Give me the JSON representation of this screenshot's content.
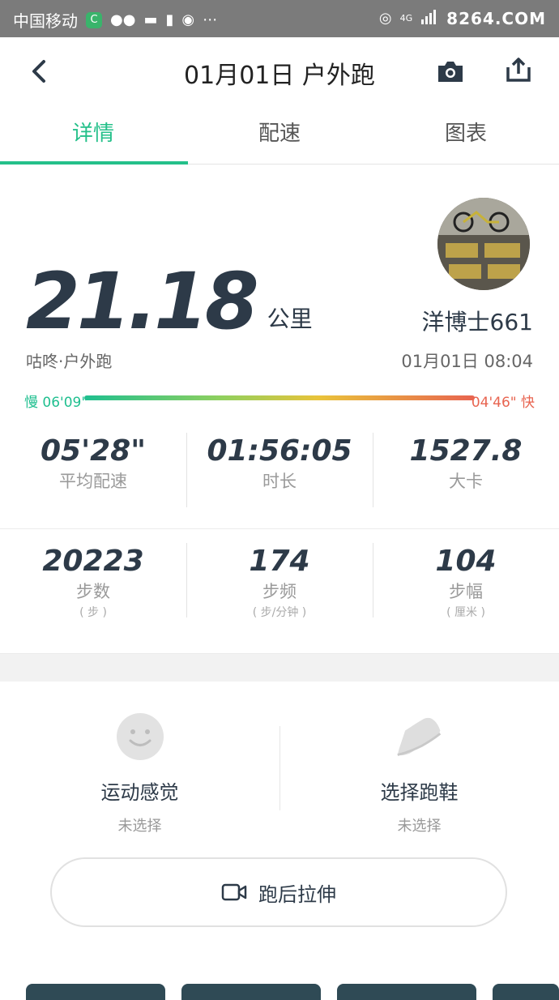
{
  "status_bar": {
    "carrier": "中国移动",
    "network": "4G",
    "watermark": "8264.COM"
  },
  "header": {
    "title": "01月01日 户外跑"
  },
  "tabs": [
    {
      "label": "详情",
      "active": true
    },
    {
      "label": "配速",
      "active": false
    },
    {
      "label": "图表",
      "active": false
    }
  ],
  "summary": {
    "distance": "21.18",
    "distance_unit": "公里",
    "subtitle": "咕咚·户外跑",
    "username": "洋博士661",
    "datetime": "01月01日 08:04"
  },
  "pace_range": {
    "slow_label": "慢 06'09\"",
    "fast_label": "04'46\" 快"
  },
  "stats_row1": [
    {
      "value": "05'28\"",
      "label": "平均配速"
    },
    {
      "value": "01:56:05",
      "label": "时长"
    },
    {
      "value": "1527.8",
      "label": "大卡"
    }
  ],
  "stats_row2": [
    {
      "value": "20223",
      "label": "步数",
      "unit": "( 步 )"
    },
    {
      "value": "174",
      "label": "步频",
      "unit": "( 步/分钟 )"
    },
    {
      "value": "104",
      "label": "步幅",
      "unit": "( 厘米 )"
    }
  ],
  "feel": {
    "feeling_title": "运动感觉",
    "feeling_sub": "未选择",
    "shoe_title": "选择跑鞋",
    "shoe_sub": "未选择"
  },
  "stretch_button": {
    "label": "跑后拉伸"
  },
  "colors": {
    "accent": "#24c08a",
    "text_dark": "#2d3a48",
    "pace_slow": "#1fbf8f",
    "pace_fast": "#e86450"
  },
  "icons": {
    "back": "chevron-left-icon",
    "camera": "camera-icon",
    "share": "share-icon",
    "feeling": "smiley-icon",
    "shoe": "running-shoe-icon",
    "video": "video-camera-icon"
  }
}
